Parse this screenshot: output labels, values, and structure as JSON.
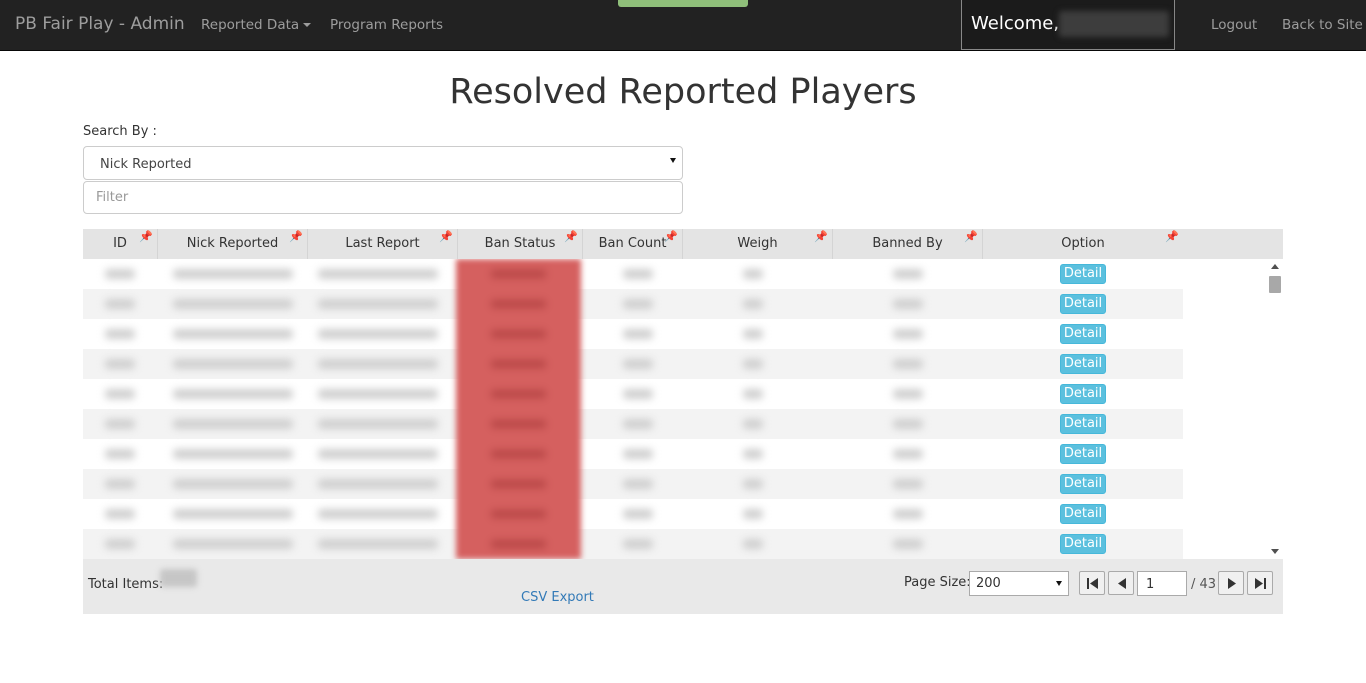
{
  "navbar": {
    "brand": "PB Fair Play - Admin",
    "menu": [
      {
        "label": "Reported Data"
      },
      {
        "label": "Program Reports"
      }
    ],
    "welcome": "Welcome,",
    "logout": "Logout",
    "back_to_site": "Back to Site"
  },
  "page": {
    "title": "Resolved Reported Players",
    "search_by_label": "Search By :",
    "search_by_value": "Nick Reported",
    "filter_placeholder": "Filter"
  },
  "grid": {
    "columns": [
      "ID",
      "Nick Reported",
      "Last Report",
      "Ban Status",
      "Ban Count",
      "Weigh",
      "Banned By",
      "Option"
    ],
    "detail_label": "Detail",
    "row_count": 10,
    "colors": {
      "ban_status": "#d5605f",
      "detail_button": "#5bc0de"
    }
  },
  "footer": {
    "total_items_label": "Total Items:",
    "csv_export": "CSV Export",
    "page_size_label": "Page Size:",
    "page_size_value": "200",
    "current_page": "1",
    "total_pages": "/ 43"
  }
}
